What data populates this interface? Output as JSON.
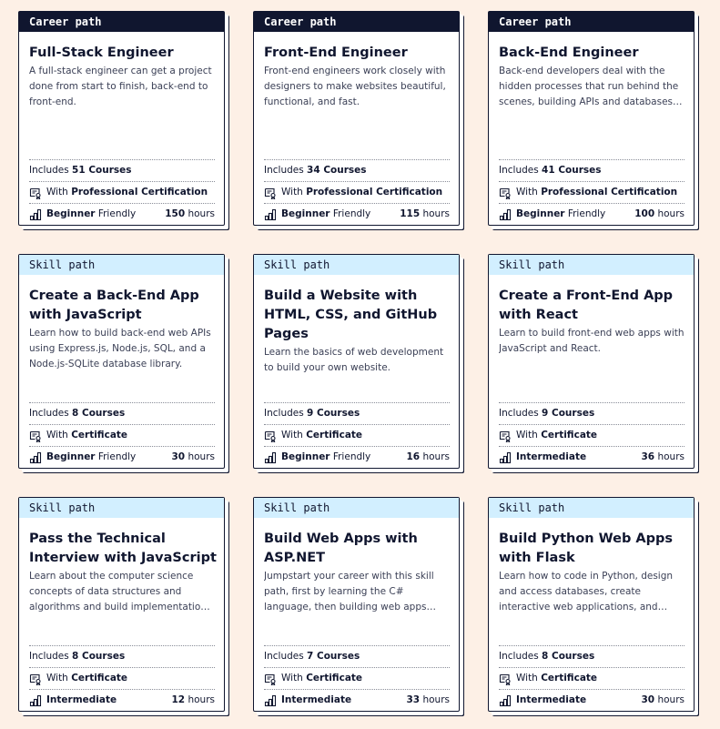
{
  "cards": [
    {
      "tag": "Career path",
      "title": "Full-Stack Engineer",
      "desc": "A full-stack engineer can get a project done from start to finish, back-end to front-end.",
      "includes_prefix": "Includes",
      "includes_count": "51 Courses",
      "cert_prefix": "With",
      "cert": "Professional Certification",
      "level": "Beginner",
      "level_suffix": "Friendly",
      "hours_num": "150",
      "hours_unit": "hours"
    },
    {
      "tag": "Career path",
      "title": "Front-End Engineer",
      "desc": "Front-end engineers work closely with designers to make websites beautiful, functional, and fast.",
      "includes_prefix": "Includes",
      "includes_count": "34 Courses",
      "cert_prefix": "With",
      "cert": "Professional Certification",
      "level": "Beginner",
      "level_suffix": "Friendly",
      "hours_num": "115",
      "hours_unit": "hours"
    },
    {
      "tag": "Career path",
      "title": "Back-End Engineer",
      "desc": "Back-end developers deal with the hidden processes that run behind the scenes, building APIs and databases that power t…",
      "includes_prefix": "Includes",
      "includes_count": "41 Courses",
      "cert_prefix": "With",
      "cert": "Professional Certification",
      "level": "Beginner",
      "level_suffix": "Friendly",
      "hours_num": "100",
      "hours_unit": "hours"
    },
    {
      "tag": "Skill path",
      "title": "Create a Back-End App with JavaScript",
      "desc": "Learn how to build back-end web APIs using Express.js, Node.js, SQL, and a Node.js-SQLite database library.",
      "includes_prefix": "Includes",
      "includes_count": "8 Courses",
      "cert_prefix": "With",
      "cert": "Certificate",
      "level": "Beginner",
      "level_suffix": "Friendly",
      "hours_num": "30",
      "hours_unit": "hours"
    },
    {
      "tag": "Skill path",
      "title": "Build a Website with HTML, CSS, and GitHub Pages",
      "desc": "Learn the basics of web development to build your own website.",
      "includes_prefix": "Includes",
      "includes_count": "9 Courses",
      "cert_prefix": "With",
      "cert": "Certificate",
      "level": "Beginner",
      "level_suffix": "Friendly",
      "hours_num": "16",
      "hours_unit": "hours"
    },
    {
      "tag": "Skill path",
      "title": "Create a Front-End App with React",
      "desc": "Learn to build front-end web apps with JavaScript and React.",
      "includes_prefix": "Includes",
      "includes_count": "9 Courses",
      "cert_prefix": "With",
      "cert": "Certificate",
      "level": "Intermediate",
      "level_suffix": "",
      "hours_num": "36",
      "hours_unit": "hours"
    },
    {
      "tag": "Skill path",
      "title": "Pass the Technical Interview with JavaScript",
      "desc": "Learn about the computer science concepts of data structures and algorithms and build implementations from scratch i…",
      "includes_prefix": "Includes",
      "includes_count": "8 Courses",
      "cert_prefix": "With",
      "cert": "Certificate",
      "level": "Intermediate",
      "level_suffix": "",
      "hours_num": "12",
      "hours_unit": "hours"
    },
    {
      "tag": "Skill path",
      "title": "Build Web Apps with ASP.NET",
      "desc": "Jumpstart your career with this skill path, first by learning the C# language, then building web apps with ASP.NET Core and…",
      "includes_prefix": "Includes",
      "includes_count": "7 Courses",
      "cert_prefix": "With",
      "cert": "Certificate",
      "level": "Intermediate",
      "level_suffix": "",
      "hours_num": "33",
      "hours_unit": "hours"
    },
    {
      "tag": "Skill path",
      "title": "Build Python Web Apps with Flask",
      "desc": "Learn how to code in Python, design and access databases, create interactive web applications, and share your apps with th…",
      "includes_prefix": "Includes",
      "includes_count": "8 Courses",
      "cert_prefix": "With",
      "cert": "Certificate",
      "level": "Intermediate",
      "level_suffix": "",
      "hours_num": "30",
      "hours_unit": "hours"
    }
  ],
  "icons": {
    "certificate": "certificate-icon",
    "level": "signal-bars-icon"
  },
  "colors": {
    "page_bg": "#fdf0e6",
    "navy": "#10162f",
    "skill_header": "#d2efff"
  }
}
